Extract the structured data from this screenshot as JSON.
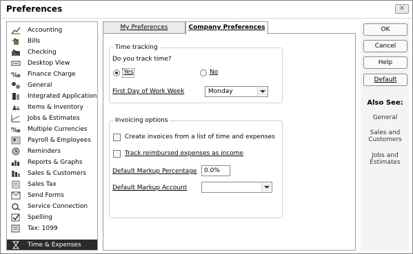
{
  "window": {
    "title": "Preferences",
    "close_glyph": "✕"
  },
  "sidebar": {
    "items": [
      {
        "label": "Accounting",
        "icon": "accounting-icon"
      },
      {
        "label": "Bills",
        "icon": "bills-icon"
      },
      {
        "label": "Checking",
        "icon": "checking-icon"
      },
      {
        "label": "Desktop View",
        "icon": "desktop-view-icon"
      },
      {
        "label": "Finance Charge",
        "icon": "finance-charge-icon"
      },
      {
        "label": "General",
        "icon": "general-icon"
      },
      {
        "label": "Integrated Applications",
        "icon": "integrated-applications-icon"
      },
      {
        "label": "Items & Inventory",
        "icon": "items-inventory-icon"
      },
      {
        "label": "Jobs & Estimates",
        "icon": "jobs-estimates-icon"
      },
      {
        "label": "Multiple Currencies",
        "icon": "multiple-currencies-icon"
      },
      {
        "label": "Payroll & Employees",
        "icon": "payroll-employees-icon"
      },
      {
        "label": "Reminders",
        "icon": "reminders-icon"
      },
      {
        "label": "Reports & Graphs",
        "icon": "reports-graphs-icon"
      },
      {
        "label": "Sales & Customers",
        "icon": "sales-customers-icon"
      },
      {
        "label": "Sales Tax",
        "icon": "sales-tax-icon"
      },
      {
        "label": "Send Forms",
        "icon": "send-forms-icon"
      },
      {
        "label": "Service Connection",
        "icon": "service-connection-icon"
      },
      {
        "label": "Spelling",
        "icon": "spelling-icon"
      },
      {
        "label": "Tax: 1099",
        "icon": "tax-1099-icon"
      },
      {
        "label": "Time & Expenses",
        "icon": "time-expenses-icon",
        "selected": true
      }
    ]
  },
  "tabs": {
    "my_preferences": "My Preferences",
    "company_preferences": "Company Preferences",
    "active": "Company Preferences"
  },
  "time_tracking": {
    "group_title": "Time tracking",
    "question": "Do you track time?",
    "yes_label": "Yes",
    "no_label": "No",
    "selected": "Yes",
    "first_day_label": "First Day of Work Week",
    "first_day_value": "Monday"
  },
  "invoicing": {
    "group_title": "Invoicing options",
    "create_invoices_label": "Create invoices from a list of time and expenses",
    "create_invoices_checked": false,
    "track_reimbursed_label": "Track reimbursed expenses as income",
    "track_reimbursed_checked": false,
    "markup_pct_label": "Default Markup Percentage",
    "markup_pct_value": "0.0%",
    "markup_account_label": "Default Markup Account",
    "markup_account_value": ""
  },
  "buttons": {
    "ok": "OK",
    "cancel": "Cancel",
    "help": "Help",
    "default": "Default"
  },
  "also_see": {
    "heading": "Also See:",
    "links": [
      "General",
      "Sales and Customers",
      "Jobs and Estimates"
    ]
  }
}
